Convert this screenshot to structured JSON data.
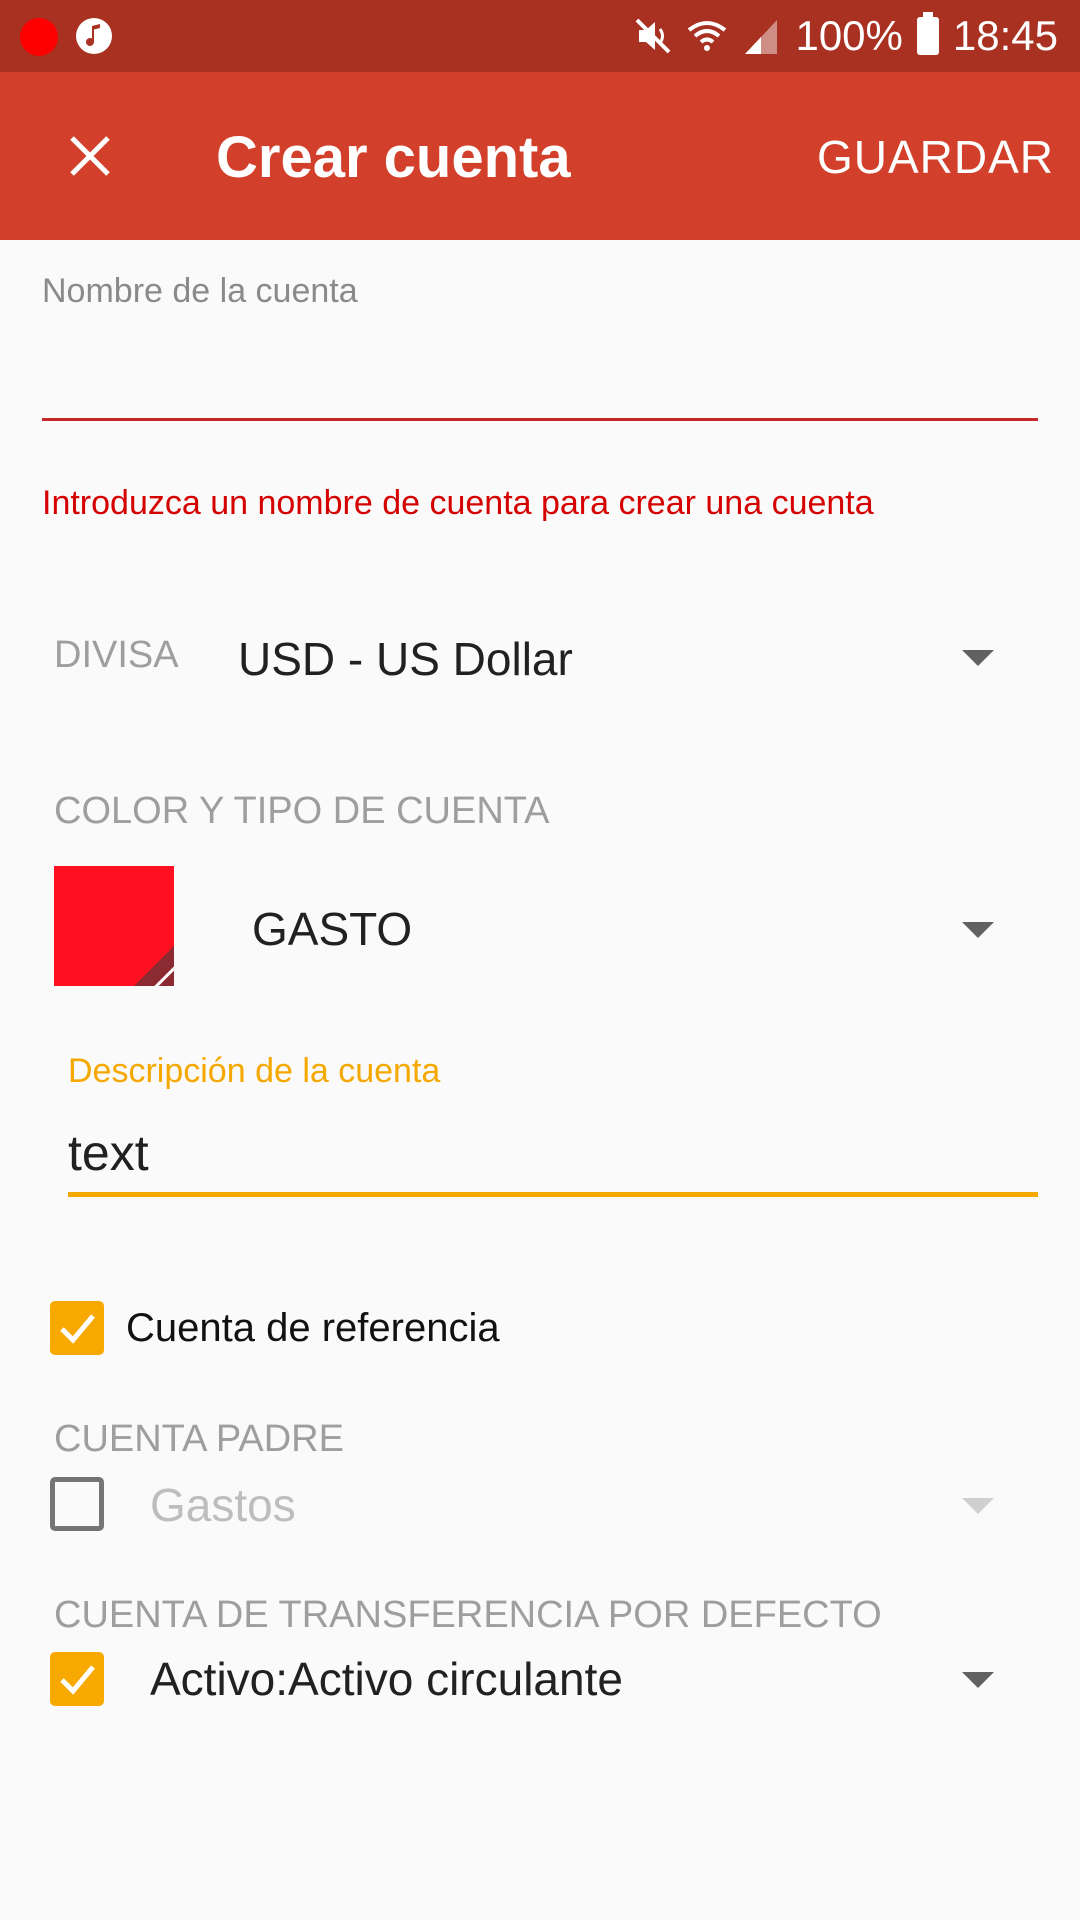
{
  "status_bar": {
    "battery": "100%",
    "time": "18:45",
    "icons": [
      "record-icon",
      "music-icon",
      "mute-icon",
      "wifi-icon",
      "signal-icon",
      "battery-icon"
    ]
  },
  "app_bar": {
    "title": "Crear cuenta",
    "save_label": "GUARDAR",
    "close_icon": "close-icon"
  },
  "form": {
    "account_name": {
      "label": "Nombre de la cuenta",
      "value": "",
      "error": "Introduzca un nombre de cuenta para crear una cuenta"
    },
    "currency": {
      "label": "DIVISA",
      "value": "USD - US Dollar"
    },
    "color_type": {
      "label": "COLOR Y TIPO DE CUENTA",
      "color": "#ff1020",
      "type_value": "GASTO"
    },
    "description": {
      "label": "Descripción de la cuenta",
      "value": "text"
    },
    "placeholder_account": {
      "label": "Cuenta de referencia",
      "checked": true
    },
    "parent_account": {
      "label": "CUENTA PADRE",
      "checked": false,
      "value": "Gastos"
    },
    "default_transfer": {
      "label": "CUENTA DE TRANSFERENCIA POR DEFECTO",
      "checked": true,
      "value": "Activo:Activo circulante"
    }
  },
  "colors": {
    "status_bar": "#a83122",
    "app_bar": "#d2402b",
    "accent": "#f5a800",
    "error": "#d50000"
  }
}
